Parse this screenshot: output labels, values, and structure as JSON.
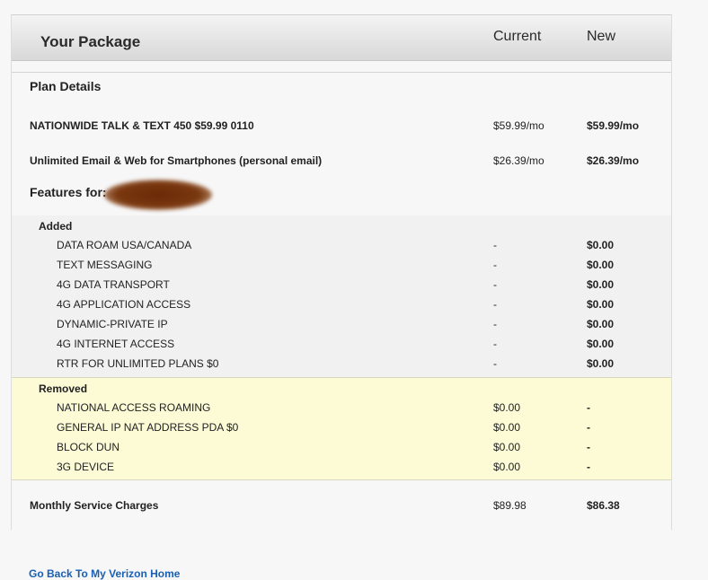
{
  "header": {
    "title": "Your Package",
    "col_current": "Current",
    "col_new": "New"
  },
  "plan": {
    "section_title": "Plan Details",
    "rows": [
      {
        "name": "NATIONWIDE TALK & TEXT 450 $59.99 0110",
        "current": "$59.99/mo",
        "new": "$59.99/mo"
      },
      {
        "name": "Unlimited Email & Web for Smartphones (personal email)",
        "current": "$26.39/mo",
        "new": "$26.39/mo"
      }
    ]
  },
  "features": {
    "title": "Features for:",
    "added": {
      "label": "Added",
      "items": [
        {
          "name": "DATA ROAM USA/CANADA",
          "current": "-",
          "new": "$0.00"
        },
        {
          "name": "TEXT MESSAGING",
          "current": "-",
          "new": "$0.00"
        },
        {
          "name": "4G DATA TRANSPORT",
          "current": "-",
          "new": "$0.00"
        },
        {
          "name": "4G APPLICATION ACCESS",
          "current": "-",
          "new": "$0.00"
        },
        {
          "name": "DYNAMIC-PRIVATE IP",
          "current": "-",
          "new": "$0.00"
        },
        {
          "name": "4G INTERNET ACCESS",
          "current": "-",
          "new": "$0.00"
        },
        {
          "name": "RTR FOR UNLIMITED PLANS $0",
          "current": "-",
          "new": "$0.00"
        }
      ]
    },
    "removed": {
      "label": "Removed",
      "items": [
        {
          "name": "NATIONAL ACCESS ROAMING",
          "current": "$0.00",
          "new": "-"
        },
        {
          "name": "GENERAL IP NAT ADDRESS PDA $0",
          "current": "$0.00",
          "new": "-"
        },
        {
          "name": "BLOCK DUN",
          "current": "$0.00",
          "new": "-"
        },
        {
          "name": "3G DEVICE",
          "current": "$0.00",
          "new": "-"
        }
      ]
    }
  },
  "totals": {
    "label": "Monthly Service Charges",
    "current": "$89.98",
    "new": "$86.38"
  },
  "footer": {
    "link": "Go Back To My Verizon Home"
  },
  "colors": {
    "link": "#1a5fb4",
    "removed_highlight": "#fcfbd6"
  }
}
